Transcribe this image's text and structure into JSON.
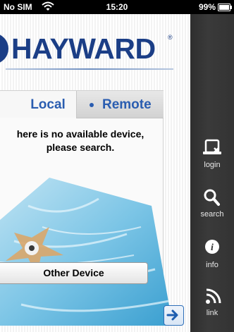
{
  "status_bar": {
    "carrier": "No SIM",
    "time": "15:20",
    "battery": "99%"
  },
  "brand": {
    "logo_text": "HAYWARD",
    "registered": "®",
    "color": "#1b3e86"
  },
  "tabs": {
    "local_label": "Local",
    "remote_label": "Remote"
  },
  "message": {
    "line1": "here is no available device,",
    "line2": "please search."
  },
  "buttons": {
    "other_device_label": "Other Device"
  },
  "sidebar": {
    "items": [
      {
        "label": "login",
        "icon": "login-icon"
      },
      {
        "label": "search",
        "icon": "search-icon"
      },
      {
        "label": "info",
        "icon": "info-icon"
      },
      {
        "label": "link",
        "icon": "link-icon"
      }
    ]
  },
  "colors": {
    "accent": "#2a5db0",
    "sidebar": "#333333"
  }
}
